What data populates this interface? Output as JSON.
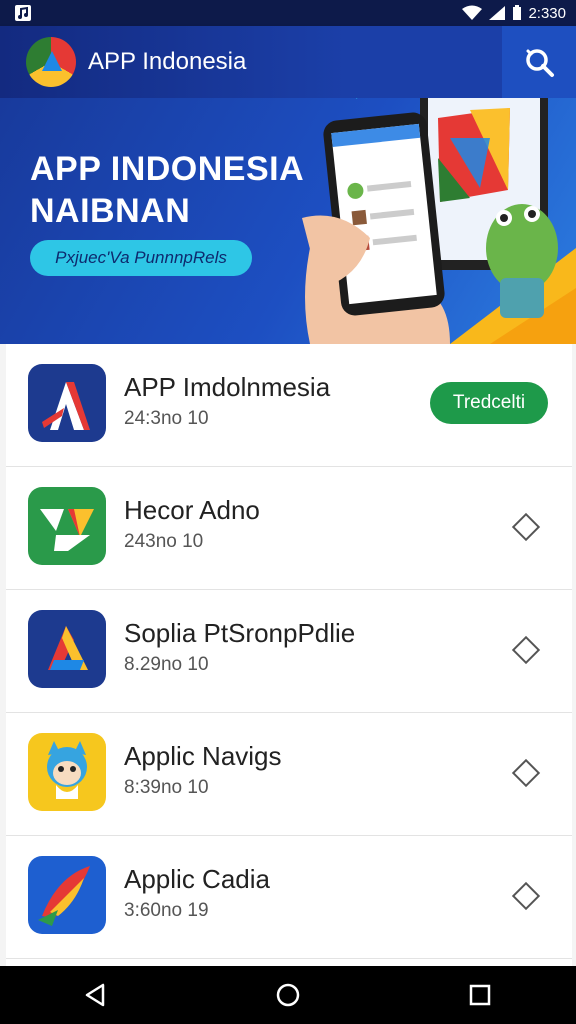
{
  "status_bar": {
    "time": "2:330",
    "icons": [
      "wifi-icon",
      "signal-icon",
      "battery-icon"
    ]
  },
  "app_bar": {
    "title": "APP Indonesia",
    "logo": "app-logo-icon",
    "search_icon": "search-icon"
  },
  "banner": {
    "title_line1": "APP INDONESIA",
    "title_line2": "NAIBNAN",
    "pill_label": "Pxjuec'Va PunnnpRels"
  },
  "apps": [
    {
      "title": "APP Imdolnmesia",
      "subtitle": "24:3no 10",
      "action": "Tredcelti"
    },
    {
      "title": "Hecor Adno",
      "subtitle": "243no 10"
    },
    {
      "title": "Soplia PtSronpPdlie",
      "subtitle": "8.29no 10"
    },
    {
      "title": "Applic Navigs",
      "subtitle": "8:39no 10"
    },
    {
      "title": "Applic Cadia",
      "subtitle": "3:60no 19"
    }
  ],
  "colors": {
    "primary": "#1b3fa8",
    "accent": "#2ec6e6",
    "install": "#1e9a4a"
  },
  "nav": {
    "back": "back-icon",
    "home": "home-icon",
    "recents": "recents-icon"
  }
}
